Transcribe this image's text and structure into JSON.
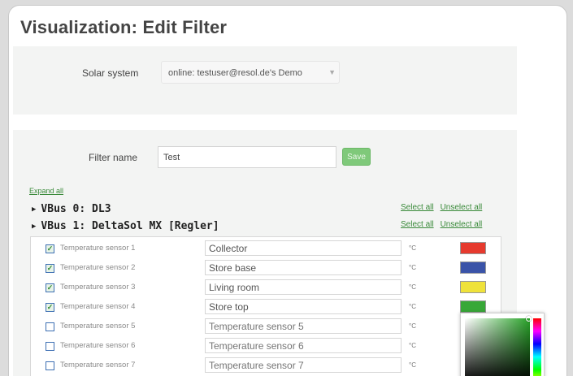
{
  "page": {
    "title": "Visualization: Edit Filter"
  },
  "solar_system": {
    "label": "Solar system",
    "selected": "online:  testuser@resol.de's Demo"
  },
  "filter": {
    "label": "Filter name",
    "value": "Test",
    "save_label": "Save"
  },
  "expand_all": "Expand all",
  "vbus": [
    {
      "label": "VBus 0: DL3",
      "select_all": "Select all",
      "unselect_all": "Unselect all"
    },
    {
      "label": "VBus 1: DeltaSol MX [Regler]",
      "select_all": "Select all",
      "unselect_all": "Unselect all"
    }
  ],
  "sensors": [
    {
      "label": "Temperature sensor 1",
      "checked": true,
      "value": "Collector",
      "placeholder": "Temperature sensor 1",
      "unit": "°C",
      "color": "#e63a2e"
    },
    {
      "label": "Temperature sensor 2",
      "checked": true,
      "value": "Store base",
      "placeholder": "Temperature sensor 2",
      "unit": "°C",
      "color": "#3a53a8"
    },
    {
      "label": "Temperature sensor 3",
      "checked": true,
      "value": "Living room",
      "placeholder": "Temperature sensor 3",
      "unit": "°C",
      "color": "#efe23a"
    },
    {
      "label": "Temperature sensor 4",
      "checked": true,
      "value": "Store top",
      "placeholder": "Temperature sensor 4",
      "unit": "°C",
      "color": "#38a838"
    },
    {
      "label": "Temperature sensor 5",
      "checked": false,
      "value": "",
      "placeholder": "Temperature sensor 5",
      "unit": "°C",
      "color": ""
    },
    {
      "label": "Temperature sensor 6",
      "checked": false,
      "value": "",
      "placeholder": "Temperature sensor 6",
      "unit": "°C",
      "color": ""
    },
    {
      "label": "Temperature sensor 7",
      "checked": false,
      "value": "",
      "placeholder": "Temperature sensor 7",
      "unit": "°C",
      "color": ""
    }
  ],
  "colors": {
    "accent_green": "#7fc97a",
    "link_green": "#3a8a3a"
  }
}
